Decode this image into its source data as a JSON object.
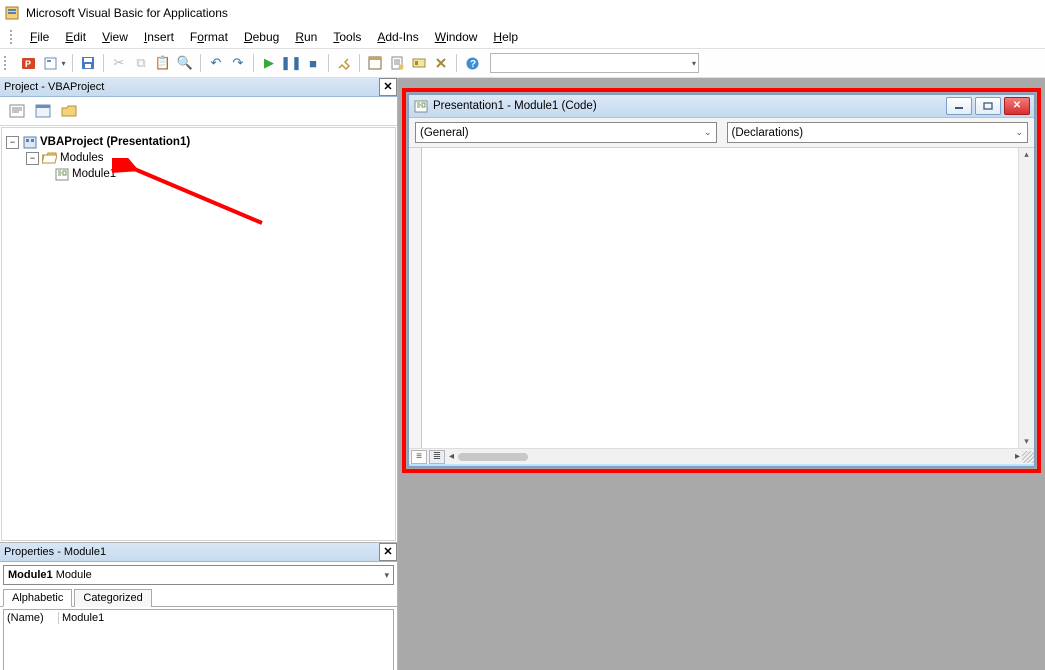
{
  "app": {
    "title": "Microsoft Visual Basic for Applications"
  },
  "menu": {
    "items": [
      "File",
      "Edit",
      "View",
      "Insert",
      "Format",
      "Debug",
      "Run",
      "Tools",
      "Add-Ins",
      "Window",
      "Help"
    ]
  },
  "project_panel": {
    "title": "Project - VBAProject",
    "root": "VBAProject (Presentation1)",
    "folder": "Modules",
    "module": "Module1"
  },
  "properties_panel": {
    "title": "Properties - Module1",
    "combo_bold": "Module1",
    "combo_type": "Module",
    "tabs": [
      "Alphabetic",
      "Categorized"
    ],
    "row_key": "(Name)",
    "row_val": "Module1"
  },
  "code_window": {
    "title": "Presentation1 - Module1 (Code)",
    "dd_left": "(General)",
    "dd_right": "(Declarations)"
  }
}
